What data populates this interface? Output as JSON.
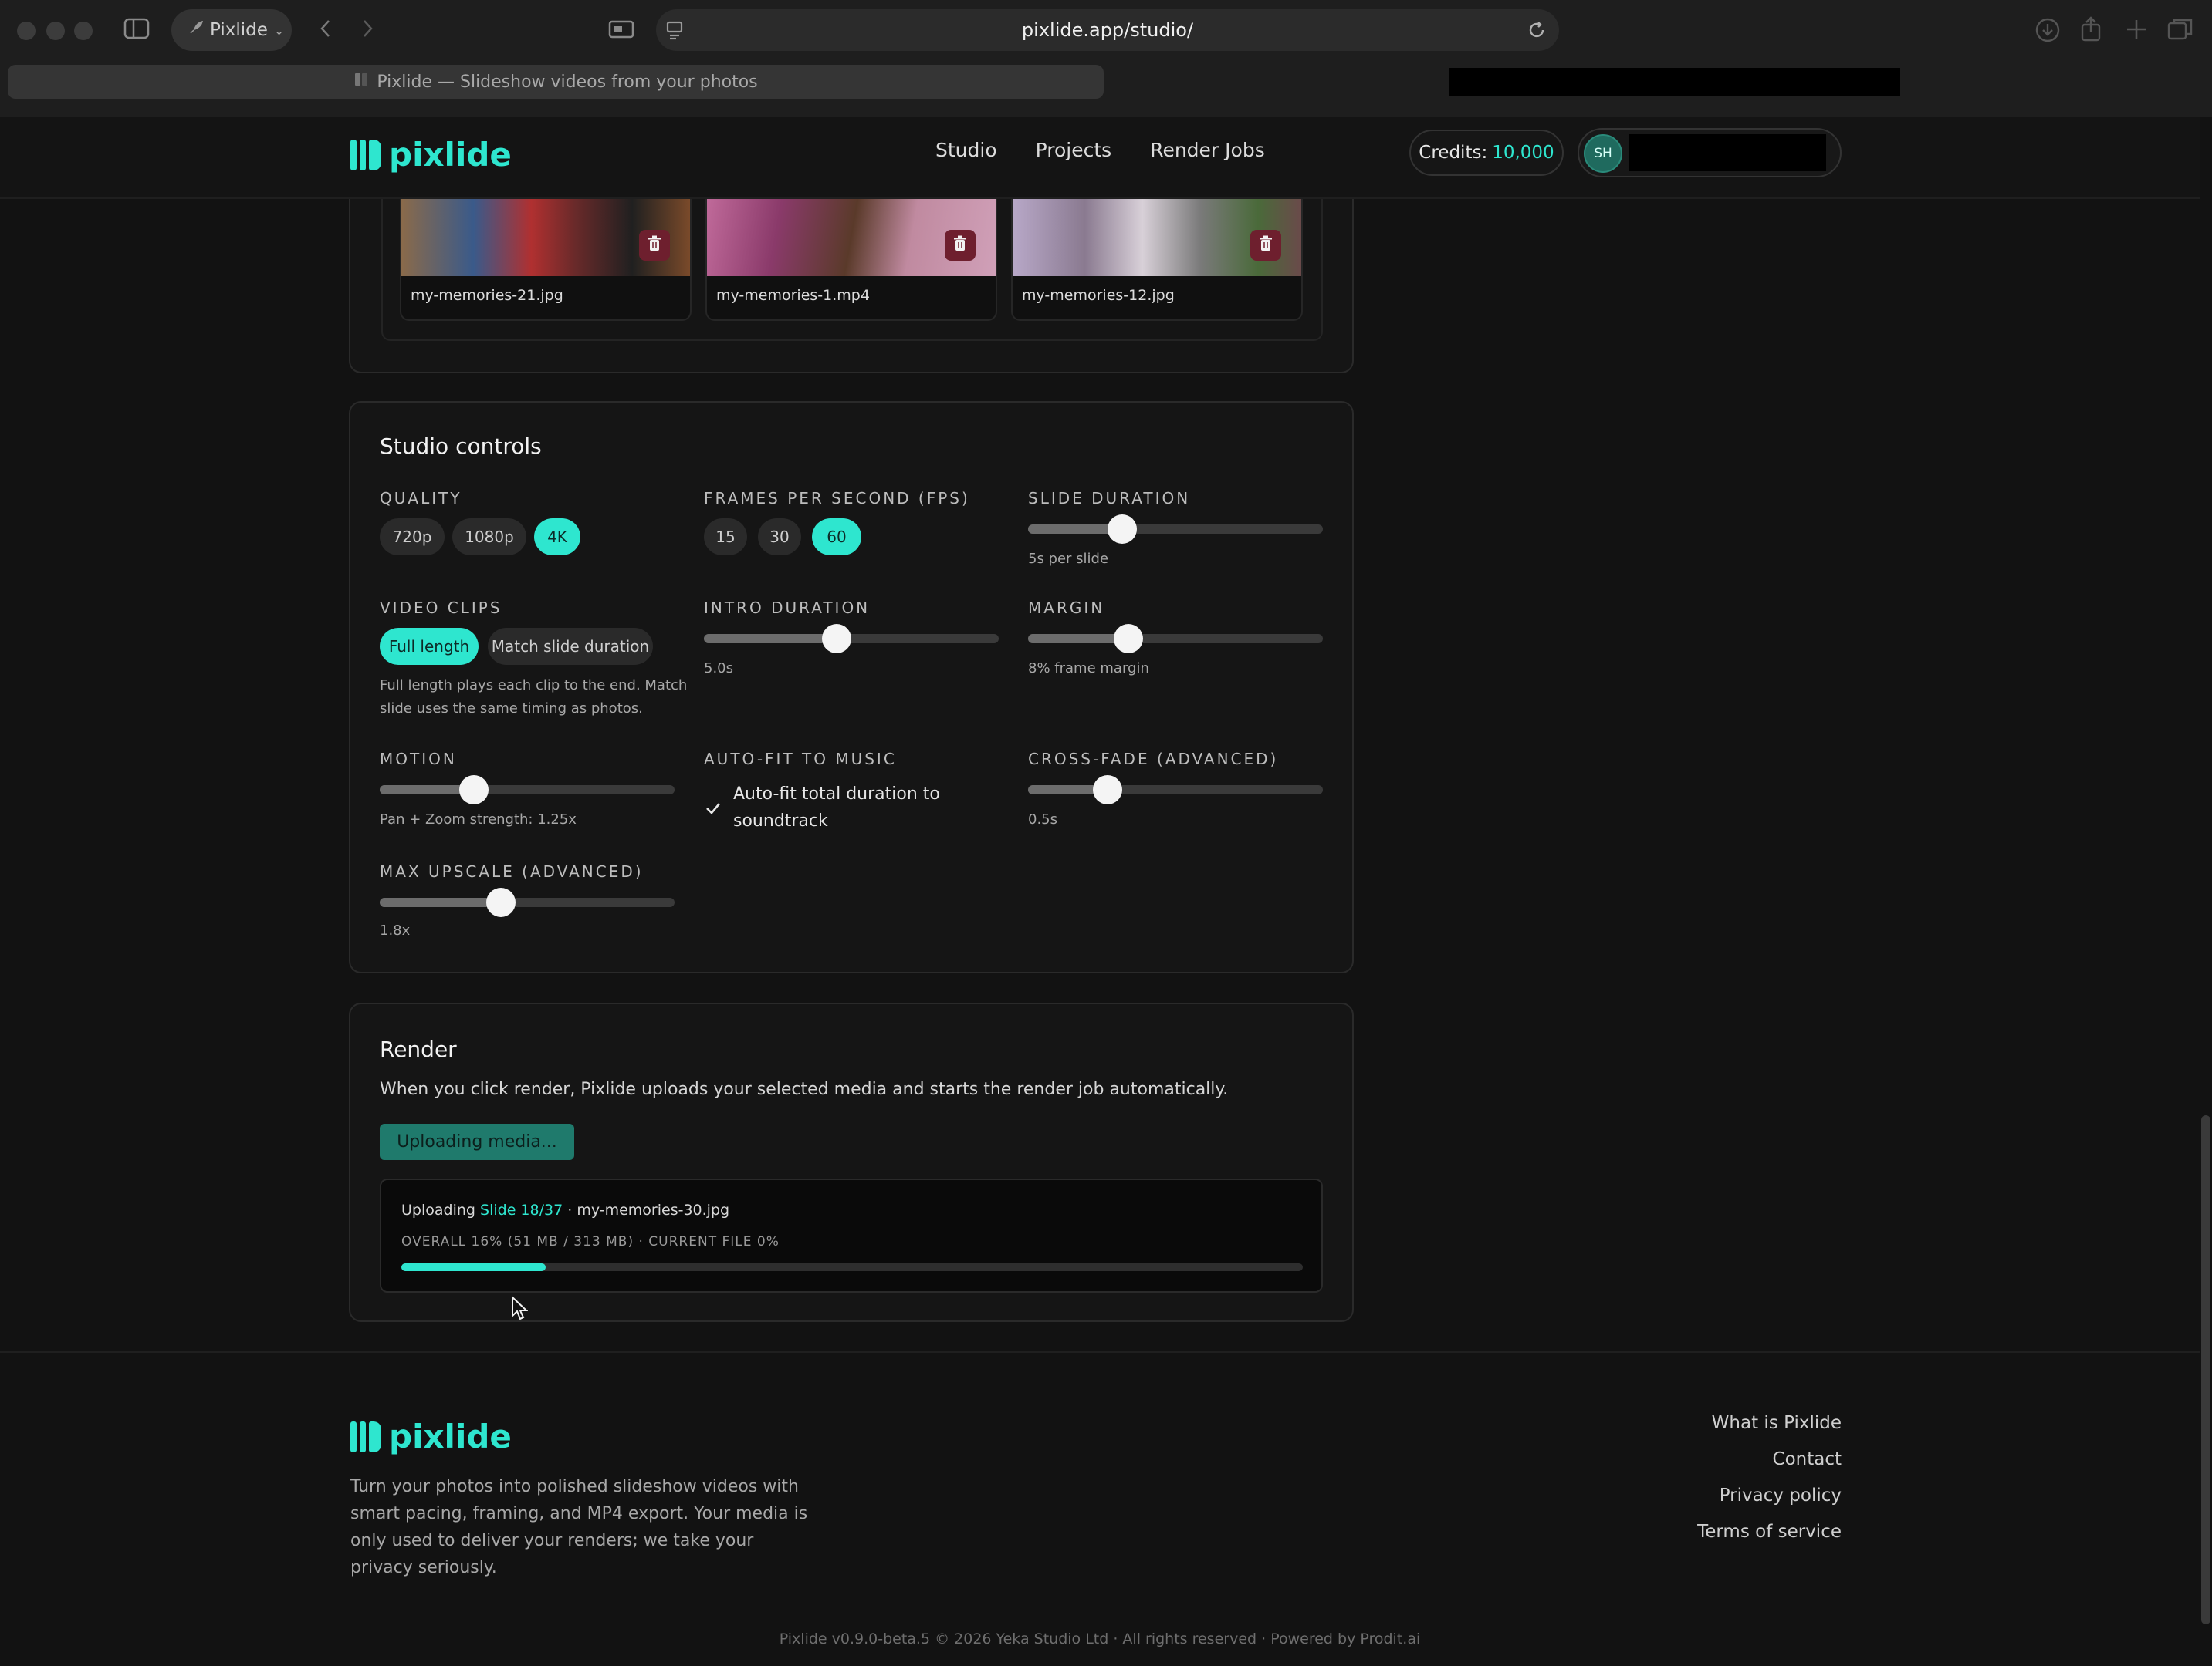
{
  "browser": {
    "profile_label": "Pixlide",
    "url": "pixlide.app/studio/",
    "tab_title": "Pixlide — Slideshow videos from your photos"
  },
  "header": {
    "logo_text": "pixlide",
    "nav": [
      "Studio",
      "Projects",
      "Render Jobs"
    ],
    "credits_label": "Credits:",
    "credits_value": "10,000",
    "avatar_initials": "SH"
  },
  "media": {
    "items": [
      {
        "name": "my-memories-21.jpg"
      },
      {
        "name": "my-memories-1.mp4"
      },
      {
        "name": "my-memories-12.jpg"
      }
    ]
  },
  "studio": {
    "title": "Studio controls",
    "quality": {
      "label": "QUALITY",
      "options": [
        "720p",
        "1080p",
        "4K"
      ],
      "selected": "4K"
    },
    "fps": {
      "label": "FRAMES PER SECOND (FPS)",
      "options": [
        "15",
        "30",
        "60"
      ],
      "selected": "60"
    },
    "slide_duration": {
      "label": "SLIDE DURATION",
      "value_text": "5s per slide",
      "level": 0.32
    },
    "video_clips": {
      "label": "VIDEO CLIPS",
      "options": [
        "Full length",
        "Match slide duration"
      ],
      "selected": "Full length",
      "help": "Full length plays each clip to the end. Match slide uses the same timing as photos."
    },
    "intro_duration": {
      "label": "INTRO DURATION",
      "value_text": "5.0s",
      "level": 0.45
    },
    "margin": {
      "label": "MARGIN",
      "value_text": "8% frame margin",
      "level": 0.34
    },
    "motion": {
      "label": "MOTION",
      "value_text": "Pan + Zoom strength: 1.25x",
      "level": 0.32
    },
    "auto_fit": {
      "label": "AUTO-FIT TO MUSIC",
      "checkbox_label": "Auto-fit total duration to soundtrack",
      "checked": true
    },
    "cross_fade": {
      "label": "CROSS-FADE (ADVANCED)",
      "value_text": "0.5s",
      "level": 0.27
    },
    "max_upscale": {
      "label": "MAX UPSCALE (ADVANCED)",
      "value_text": "1.8x",
      "level": 0.41
    }
  },
  "render": {
    "title": "Render",
    "description": "When you click render, Pixlide uploads your selected media and starts the render job automatically.",
    "button_label": "Uploading media...",
    "status_prefix": "Uploading",
    "status_slide": "Slide 18/37",
    "status_file": "· my-memories-30.jpg",
    "overall_text": "OVERALL 16% (51 MB / 313 MB) · CURRENT FILE 0%",
    "overall_progress": 0.16
  },
  "footer": {
    "logo_text": "pixlide",
    "blurb": "Turn your photos into polished slideshow videos with smart pacing, framing, and MP4 export. Your media is only used to deliver your renders; we take your privacy seriously.",
    "links": [
      "What is Pixlide",
      "Contact",
      "Privacy policy",
      "Terms of service"
    ],
    "copyright": "Pixlide v0.9.0-beta.5 © 2026 Yeka Studio Ltd · All rights reserved · Powered by Prodit.ai"
  },
  "colors": {
    "accent": "#2ee6cf",
    "background": "#121212",
    "danger": "#6e1f2e"
  }
}
